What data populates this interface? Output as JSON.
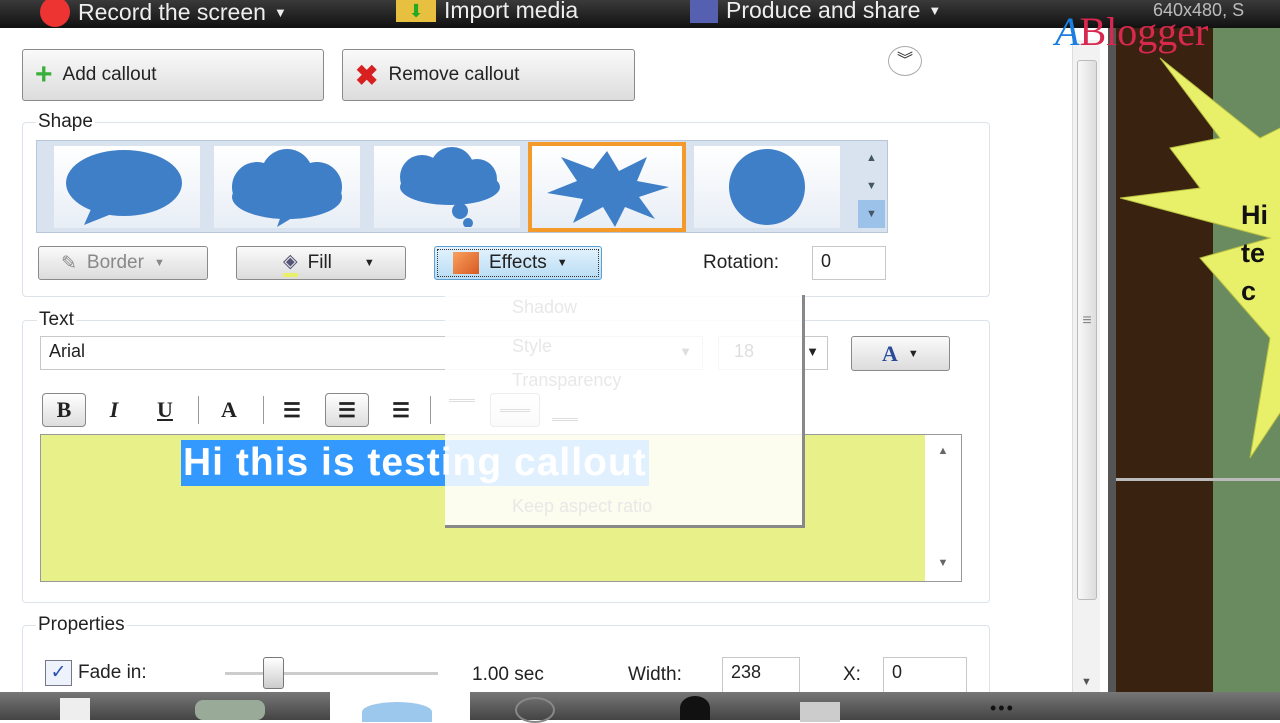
{
  "topbar": {
    "record": "Record the screen",
    "import": "Import media",
    "produce": "Produce and share",
    "resolution": "640x480, S"
  },
  "watermark": "Blogger",
  "buttons": {
    "add_callout": "Add callout",
    "remove_callout": "Remove callout"
  },
  "shape": {
    "label": "Shape",
    "shapes": [
      "speech-bubble",
      "cloud-bubble",
      "thought-bubble",
      "starburst",
      "circle"
    ],
    "selected": "starburst",
    "border": "Border",
    "fill": "Fill",
    "effects": "Effects",
    "rotation_label": "Rotation:",
    "rotation": "0"
  },
  "effects_menu": {
    "items": [
      "Shadow",
      "Style",
      "Transparency",
      "",
      "Keep aspect ratio"
    ]
  },
  "text": {
    "label": "Text",
    "font": "Arial",
    "size": "18",
    "color_button": "A",
    "content": "Hi this is testing callout",
    "format": {
      "bold": "B",
      "italic": "I",
      "underline": "U",
      "font_style": "A"
    }
  },
  "properties": {
    "label": "Properties",
    "fade_in_label": "Fade in:",
    "fade_in_checked": true,
    "fade_value": "1.00 sec",
    "width_label": "Width:",
    "width": "238",
    "x_label": "X:",
    "x": "0"
  },
  "preview": {
    "callout_text": "Hi\nte\nc"
  },
  "colors": {
    "selected_shape": "#f39a2a",
    "text_bg": "#e8f08a",
    "selection": "#3399ff",
    "shape_blue": "#3f7fc8"
  }
}
